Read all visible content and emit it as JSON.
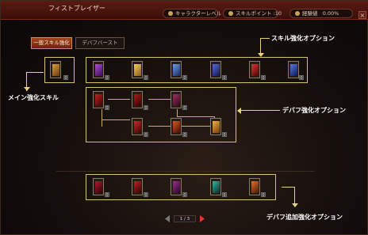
{
  "window": {
    "title": "フィストブレイザー",
    "close_label": "×"
  },
  "header": {
    "character_level_label": "キャラクターレベル",
    "skill_points_label": "スキルポイント :10",
    "experience_label": "経験値",
    "experience_value": "0.00%"
  },
  "tabs": [
    {
      "label": "一般スキル強化",
      "active": true
    },
    {
      "label": "デバフバースト",
      "active": false
    }
  ],
  "annotations": {
    "skill_enhance_option": "スキル強化オプション",
    "main_enhance_skill": "メイン強化スキル",
    "debuff_enhance_option": "デバフ強化オプション",
    "debuff_add_enhance_option": "デバフ追加強化オプション"
  },
  "main_skill": {
    "level": "0",
    "icon": "main-skill-icon",
    "color": "#b07a2a"
  },
  "top_row": [
    {
      "level": "0",
      "icon": "purple-skill-icon",
      "color": "#7a2a9a"
    },
    {
      "level": "0",
      "icon": "gold-skill-icon",
      "color": "#c9a030"
    },
    {
      "level": "0",
      "icon": "blue-skill-icon",
      "color": "#3a5ac0"
    },
    {
      "level": "0",
      "icon": "blue-skill-icon",
      "color": "#2a3a9a"
    },
    {
      "level": "0",
      "icon": "red-skill-icon",
      "color": "#b01818"
    },
    {
      "level": "0",
      "icon": "blue-skill-icon",
      "color": "#2a4aa8"
    }
  ],
  "debuff_row1": [
    {
      "level": "0",
      "icon": "red-debuff-icon",
      "color": "#9a1010"
    },
    {
      "level": "0",
      "icon": "red-debuff-icon",
      "color": "#8a1010"
    },
    {
      "level": "0",
      "icon": "purple-debuff-icon",
      "color": "#7a1a3a"
    }
  ],
  "debuff_row2": [
    {
      "level": "0",
      "icon": "red-debuff-icon",
      "color": "#a01818"
    },
    {
      "level": "0",
      "icon": "fire-debuff-icon",
      "color": "#b03010"
    },
    {
      "level": "0",
      "icon": "gold-debuff-icon",
      "color": "#c98a20"
    }
  ],
  "bottom_row": [
    {
      "level": "0",
      "icon": "red-extra-icon",
      "color": "#8a1020"
    },
    {
      "level": "0",
      "icon": "red-extra-icon",
      "color": "#9a1515"
    },
    {
      "level": "0",
      "icon": "purple-extra-icon",
      "color": "#6a2070"
    },
    {
      "level": "0",
      "icon": "green-extra-icon",
      "color": "#2a7a6a"
    },
    {
      "level": "0",
      "icon": "fire-extra-icon",
      "color": "#b04a1a"
    }
  ],
  "pager": {
    "text": "1 / 3"
  },
  "colors": {
    "accent": "#d6c36a",
    "title_bar": "#5a1b12",
    "tab_active": "#a5441c"
  }
}
